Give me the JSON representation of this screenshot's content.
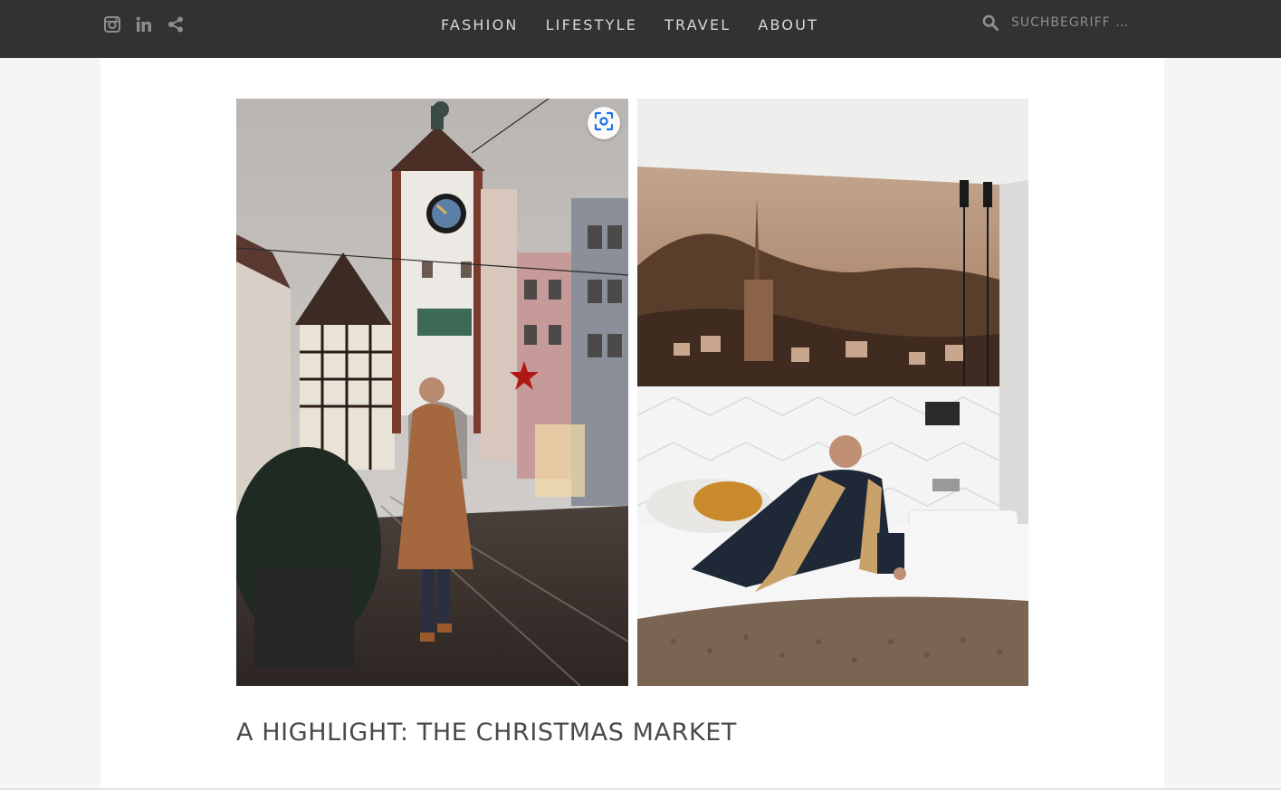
{
  "header": {
    "social": [
      {
        "icon": "instagram-icon"
      },
      {
        "icon": "linkedin-icon"
      },
      {
        "icon": "share-icon"
      }
    ],
    "nav": [
      {
        "label": "FASHION"
      },
      {
        "label": "LIFESTYLE"
      },
      {
        "label": "TRAVEL"
      },
      {
        "label": "ABOUT"
      }
    ],
    "search": {
      "placeholder": "SUCHBEGRIFF …",
      "icon": "search-icon"
    }
  },
  "article": {
    "images": [
      {
        "name": "freiburg-city-gate-photo"
      },
      {
        "name": "hotel-room-photo"
      }
    ],
    "lens_button": {
      "icon": "visual-search-icon"
    },
    "heading": "A HIGHLIGHT: THE CHRISTMAS MARKET"
  },
  "colors": {
    "topbar": "#333231",
    "nav_text": "#d8d8d8",
    "page_bg": "#f5f5f5",
    "card_bg": "#ffffff",
    "heading": "#4a4a4a",
    "lens_accent": "#1a73e8"
  }
}
